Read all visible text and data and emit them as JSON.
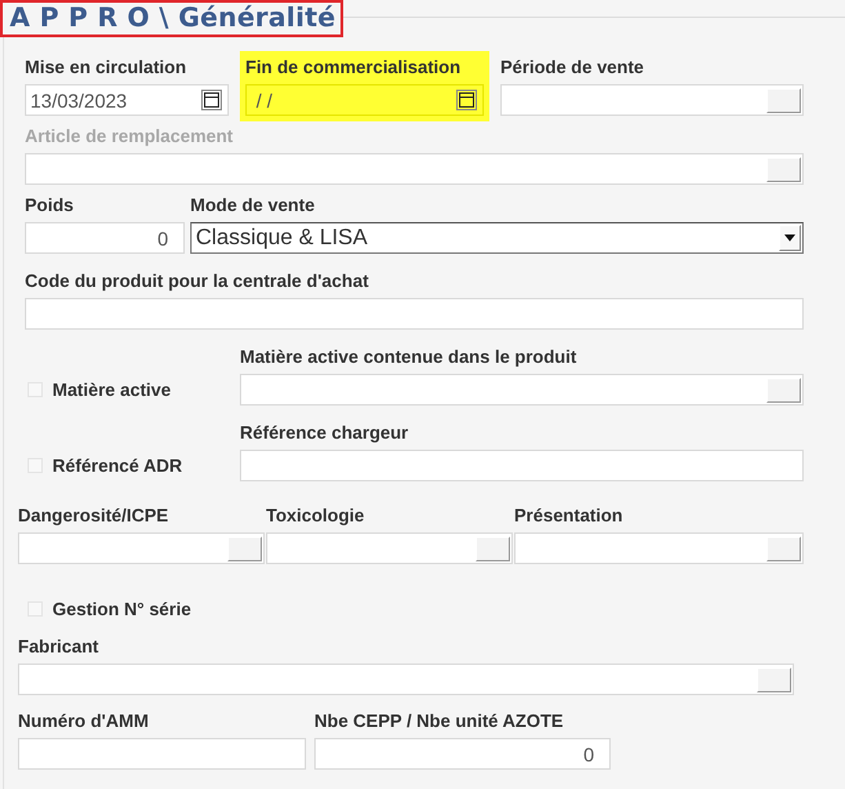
{
  "title": "A P P R O \\ Généralité",
  "rows": [
    {
      "items": [
        {
          "kind": "date",
          "label": "Mise en circulation",
          "value": "13/03/2023",
          "highlighted": false,
          "disabled": false
        },
        {
          "kind": "date",
          "label": "Fin de commercialisation",
          "value": " / /",
          "highlighted": true,
          "disabled": false
        },
        {
          "kind": "lookup",
          "label": "Période de vente",
          "highlighted": false,
          "disabled": false
        }
      ]
    },
    {
      "items": [
        {
          "kind": "lookup",
          "label": "Article de remplacement",
          "highlighted": false,
          "disabled": true
        }
      ]
    },
    {
      "items": [
        {
          "kind": "number",
          "label": "Poids",
          "value": "0",
          "highlighted": false,
          "disabled": false
        },
        {
          "kind": "select",
          "label": "Mode de vente",
          "value": "Classique & LISA",
          "highlighted": false,
          "disabled": false
        }
      ]
    },
    {
      "items": [
        {
          "kind": "text",
          "label": "Code du produit pour la centrale d'achat",
          "highlighted": false,
          "disabled": false
        }
      ]
    },
    {
      "items": [
        {
          "kind": "checkbox",
          "label": "Matière active",
          "checked": false
        },
        {
          "kind": "lookup",
          "label": "Matière active contenue dans le produit",
          "highlighted": false,
          "disabled": false
        }
      ]
    },
    {
      "items": [
        {
          "kind": "checkbox",
          "label": "Référencé ADR",
          "checked": false
        },
        {
          "kind": "text",
          "label": "Référence chargeur",
          "highlighted": false,
          "disabled": false
        }
      ]
    },
    {
      "items": [
        {
          "kind": "lookup",
          "label": "Dangerosité/ICPE",
          "highlighted": false,
          "disabled": false
        },
        {
          "kind": "lookup",
          "label": "Toxicologie",
          "highlighted": false,
          "disabled": false
        },
        {
          "kind": "lookup",
          "label": "Présentation",
          "highlighted": false,
          "disabled": false
        }
      ]
    },
    {
      "items": [
        {
          "kind": "checkbox",
          "label": "Gestion N° série",
          "checked": false
        }
      ]
    },
    {
      "items": [
        {
          "kind": "lookup",
          "label": "Fabricant",
          "highlighted": false,
          "disabled": false
        }
      ]
    },
    {
      "items": [
        {
          "kind": "text",
          "label": "Numéro d'AMM",
          "highlighted": false,
          "disabled": false
        },
        {
          "kind": "number",
          "label": "Nbe CEPP / Nbe unité AZOTE",
          "value": "0",
          "highlighted": false,
          "disabled": false
        }
      ]
    }
  ]
}
